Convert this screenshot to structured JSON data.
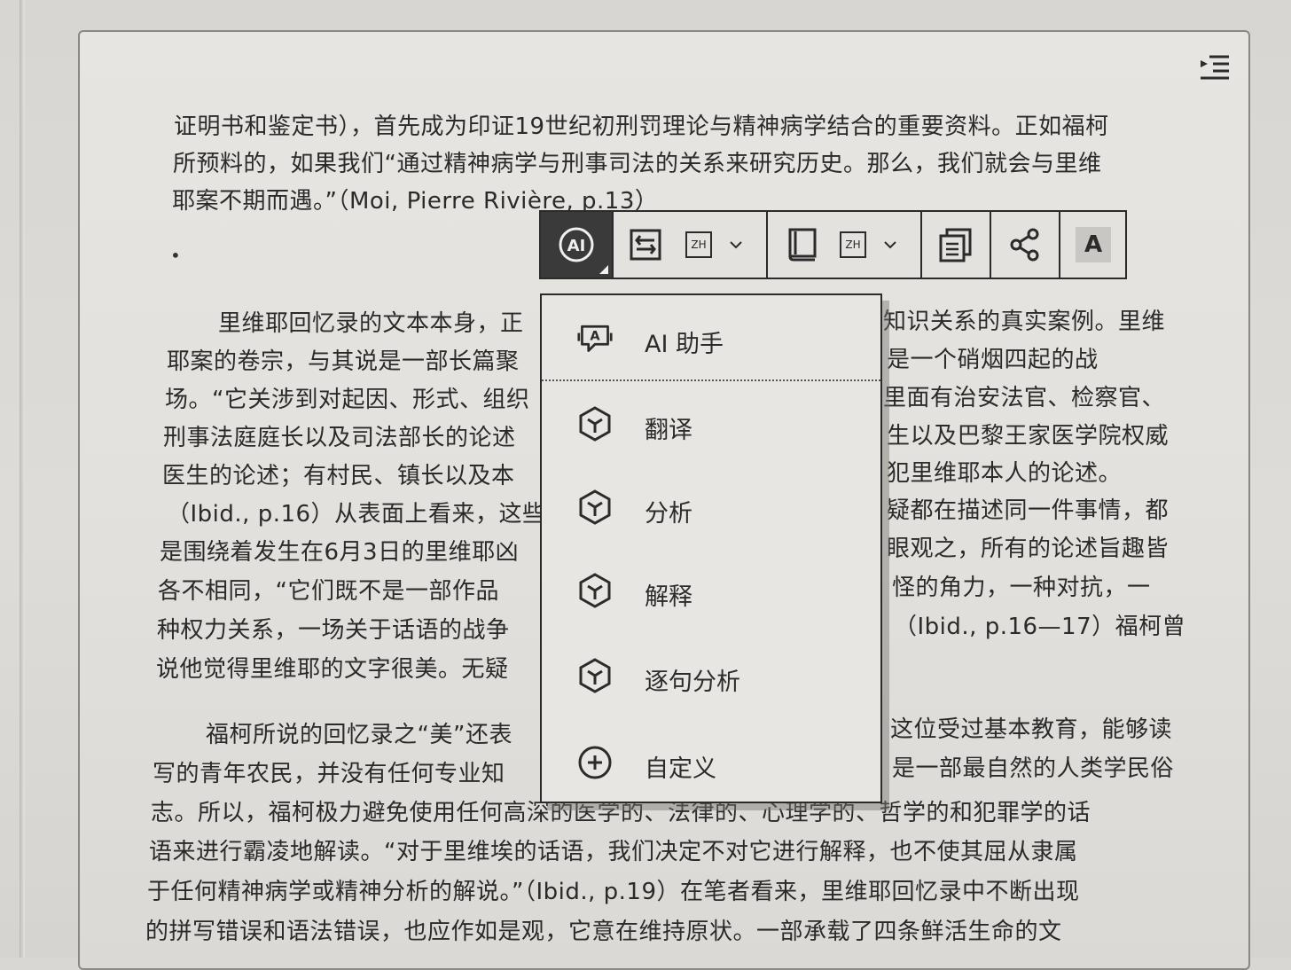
{
  "page_text": {
    "lines": [
      "证明书和鉴定书），首先成为印证19世纪初刑罚理论与精神病学结合的重要资料。正如福柯",
      "所预料的，如果我们“通过精神病学与刑事司法的关系来研究历史。那么，我们就会与里维",
      "耶案不期而遇。”（Moi, Pierre Rivière, p.13）",
      "里维耶回忆录的文本本身，正",
      "耶案的卷宗，与其说是一部长篇聚",
      "场。“它关涉到对起因、形式、组织",
      "刑事法庭庭长以及司法部长的论述",
      "医生的论述；有村民、镇长以及本",
      "（Ibid., p.16）从表面上看来，这些",
      "是围绕着发生在6月3日的里维耶凶",
      "各不相同，“它们既不是一部作品",
      "种权力关系，一场关于话语的战争",
      "说他觉得里维耶的文字很美。无疑",
      "福柯所说的回忆录之“美”还表",
      "写的青年农民，并没有任何专业知",
      "志。所以，福柯极力避免使用任何高深的医学的、法律的、心理学的、哲学的和犯罪学的话",
      "语来进行霸凌地解读。“对于里维埃的话语，我们决定不对它进行解释，也不使其屈从隶属",
      "于任何精神病学或精神分析的解说。”（Ibid., p.19）在笔者看来，里维耶回忆录中不断出现",
      "的拼写错误和语法错误，也应作如是观，它意在维持原状。一部承载了四条鲜活生命的文"
    ],
    "right_fragments": [
      "知识关系的真实案例。里维",
      "是一个硝烟四起的战",
      "里面有治安法官、检察官、",
      "生以及巴黎王家医学院权威",
      "犯里维耶本人的论述。",
      "疑都在描述同一件事情，都",
      "眼观之，所有的论述旨趣皆",
      "怪的角力，一种对抗，一",
      "（Ibid., p.16—17）福柯曾",
      "这位受过基本教育，能够读",
      "是一部最自然的人类学民俗"
    ]
  },
  "toolbar": {
    "ai_icon": "ai-assistant-icon",
    "translate_icon": "translate-icon",
    "translate_lang": "ZH",
    "dictionary_icon": "dictionary-icon",
    "dictionary_lang": "ZH",
    "copy_icon": "copy-text-icon",
    "share_icon": "share-icon",
    "font_label": "A"
  },
  "ai_menu": {
    "items": [
      {
        "label": "AI 助手",
        "icon": "ai-chat-icon"
      },
      {
        "label": "翻译",
        "icon": "cube-icon"
      },
      {
        "label": "分析",
        "icon": "cube-icon"
      },
      {
        "label": "解释",
        "icon": "cube-icon"
      },
      {
        "label": "逐句分析",
        "icon": "cube-icon"
      },
      {
        "label": "自定义",
        "icon": "plus-circle-icon"
      }
    ]
  },
  "colors": {
    "paper": "#e4e2de",
    "ink": "#2b2b2b",
    "ai_button_bg": "#3a3a3a"
  }
}
